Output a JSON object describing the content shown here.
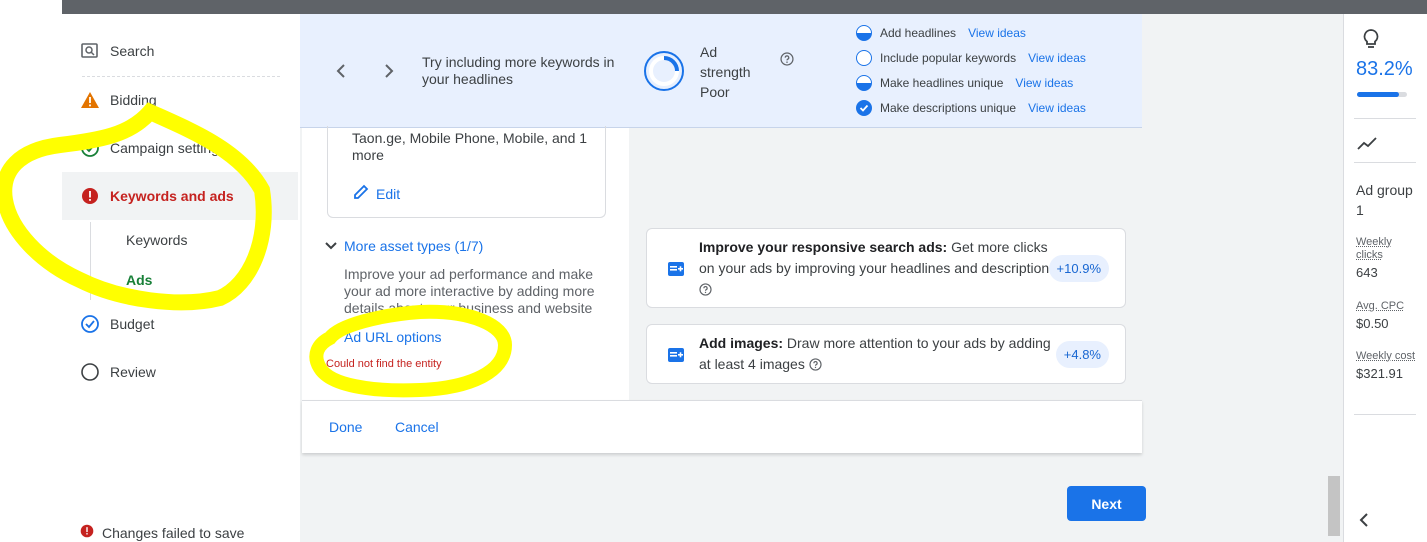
{
  "sidebar": {
    "items": [
      {
        "label": "Search",
        "icon": "search-campaign-icon"
      },
      {
        "label": "Bidding",
        "icon": "warning-icon"
      },
      {
        "label": "Campaign settings",
        "icon": "check-circle-icon"
      },
      {
        "label": "Keywords and ads",
        "icon": "error-icon"
      },
      {
        "label": "Budget",
        "icon": "check-circle-icon"
      },
      {
        "label": "Review",
        "icon": "empty-circle-icon"
      }
    ],
    "sub_items": [
      {
        "label": "Keywords"
      },
      {
        "label": "Ads"
      }
    ],
    "status": "Changes failed to save"
  },
  "banner": {
    "tip": "Try including more keywords in your headlines",
    "ad_strength_label": "Ad strength",
    "ad_strength_value": "Poor",
    "checklist": [
      {
        "label": "Add headlines",
        "link": "View ideas",
        "state": "half"
      },
      {
        "label": "Include popular keywords",
        "link": "View ideas",
        "state": "empty"
      },
      {
        "label": "Make headlines unique",
        "link": "View ideas",
        "state": "half"
      },
      {
        "label": "Make descriptions unique",
        "link": "View ideas",
        "state": "done"
      }
    ]
  },
  "editor": {
    "keywords_text": "Taon.ge, Mobile Phone, Mobile, and 1 more",
    "edit_label": "Edit",
    "more_asset_types": "More asset types (1/7)",
    "more_asset_desc": "Improve your ad performance and make your ad more interactive by adding more details about your business and website",
    "ad_url_options": "Ad URL options",
    "error": "Could not find the entity"
  },
  "footer": {
    "done": "Done",
    "cancel": "Cancel"
  },
  "recommendations": [
    {
      "title": "Improve your responsive search ads:",
      "text": "Get more clicks on your ads by improving your headlines and descriptions",
      "uplift": "+10.9%"
    },
    {
      "title": "Add images:",
      "text": "Draw more attention to your ads by adding at least 4 images",
      "uplift": "+4.8%"
    }
  ],
  "next_label": "Next",
  "right_panel": {
    "optimization_score": "83.2%",
    "score_fraction": 0.832,
    "group_title": "Ad group 1",
    "stats": [
      {
        "label": "Weekly clicks",
        "value": "643"
      },
      {
        "label": "Avg. CPC",
        "value": "$0.50"
      },
      {
        "label": "Weekly cost",
        "value": "$321.91"
      }
    ]
  },
  "colors": {
    "accent": "#1a73e8",
    "error": "#c5221f",
    "success": "#188038",
    "warning": "#e37400",
    "highlight": "#ffff00"
  }
}
